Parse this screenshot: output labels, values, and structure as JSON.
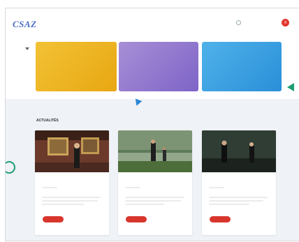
{
  "header": {
    "logo": "CSAZ",
    "logo_sub": "",
    "org_line1": "",
    "org_line2": ""
  },
  "nav": {
    "links": [
      "",
      "",
      "",
      "",
      ""
    ],
    "cta_symbol": "g"
  },
  "side": {
    "label": ""
  },
  "cards": [
    {
      "title": "",
      "desc": "",
      "color": "#f0b525"
    },
    {
      "title": "",
      "desc": "",
      "color": "#9a82d2"
    },
    {
      "title": "",
      "desc": "",
      "color": "#3ca3e6"
    }
  ],
  "news": {
    "pre": "",
    "title": "ACTUALITÉS",
    "see_all": "",
    "items": [
      {
        "title": "",
        "button": ""
      },
      {
        "title": "",
        "button": ""
      },
      {
        "title": "",
        "button": ""
      }
    ]
  },
  "colors": {
    "accent_red": "#e2362d",
    "teal": "#1e9c72",
    "blue_triangle": "#2a86d6"
  }
}
